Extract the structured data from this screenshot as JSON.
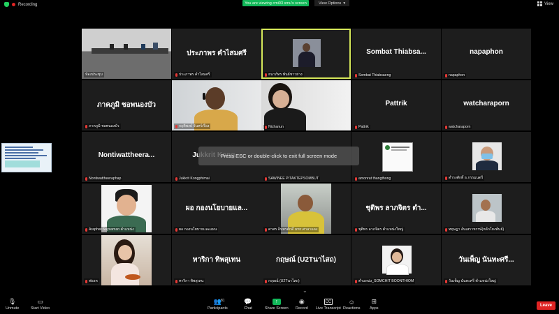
{
  "top": {
    "recording_label": "Recording",
    "viewing_banner": "You are viewing cmi03 smu's screen",
    "view_options": "View Options",
    "view_label": "View"
  },
  "toast": "Press ESC or double-click to exit full screen mode",
  "tiles": [
    {
      "label": "ห้องประชุม"
    },
    {
      "big": "ประภาพร คำไสมศรี",
      "label": "ประภาพร คำไสมศรี"
    },
    {
      "label": "ธนาภัทร พันธ์ชาวย่าง"
    },
    {
      "big": "Sombat Thiabsa...",
      "label": "Sombat Thiabsaeng"
    },
    {
      "big": "napaphon",
      "label": "napaphon"
    },
    {
      "big": "ภาคภูมิ ชอพนองบัว",
      "label": "ภาคภูมิ ชอพนองบัว"
    },
    {
      "label": "กฤติพงษ์ จันทร์เรือง"
    },
    {
      "label": "Nichanun"
    },
    {
      "big": "Pattrik",
      "label": "Pattrik"
    },
    {
      "big": "watcharaporn",
      "label": "watcharaporn"
    },
    {
      "big": "Nontiwattheera...",
      "label": "Nontiwattheeraphap"
    },
    {
      "big": "Jukkrit Kong...",
      "label": "Jukkrit Kongphimai"
    },
    {
      "big": "",
      "label": "SAWINEE PITAKTEPSOMBUT"
    },
    {
      "label": "amonrat thangthong"
    },
    {
      "label": "ดำรงศักดิ์ ธ.กรรมนตรี"
    },
    {
      "label": "Araphat Saysaman ตำแหน่ง"
    },
    {
      "big": "ผอ กองนโยบายแล...",
      "label": "ผอ กองนโยบายและแผน"
    },
    {
      "label": "ศาศร อินทรศักดิ์ มทร.ศาลาแดง"
    },
    {
      "big": "ชุติพร ลาภจิตร ตำ...",
      "label": "ชุติพร ลาภจิตร ตำแหน่งใหญ่"
    },
    {
      "label": "ทฤษฎา อันเสราหรรษ์(หลักโยงพันธ์)"
    },
    {
      "label": "ฟองค"
    },
    {
      "big": "ทาริกา ทิพสุเทน",
      "label": "ทาริกา ทิพสุเทน"
    },
    {
      "big": "กฤษณ์ (U2Tนาไสถ)",
      "label": "กฤษณ์ (U2Tนาไสถ)"
    },
    {
      "label": "ตำแหน่ง_SOMCHIT BOONTHIOM"
    },
    {
      "big": "วันเพ็ญ นันทะศรี...",
      "label": "วันเพ็ญ นันทะศรี ตำแหน่งใหญ่"
    }
  ],
  "toolbar": {
    "unmute": "Unmute",
    "start_video": "Start Video",
    "participants": "Participants",
    "participants_count": "81",
    "chat": "Chat",
    "share_screen": "Share Screen",
    "record": "Record",
    "live_transcript": "Live Transcript",
    "reactions": "Reactions",
    "apps": "Apps",
    "leave": "Leave"
  },
  "colors": {
    "share_green": "#12b85a",
    "leave_red": "#e02424",
    "active_outline": "#d6e85a"
  }
}
